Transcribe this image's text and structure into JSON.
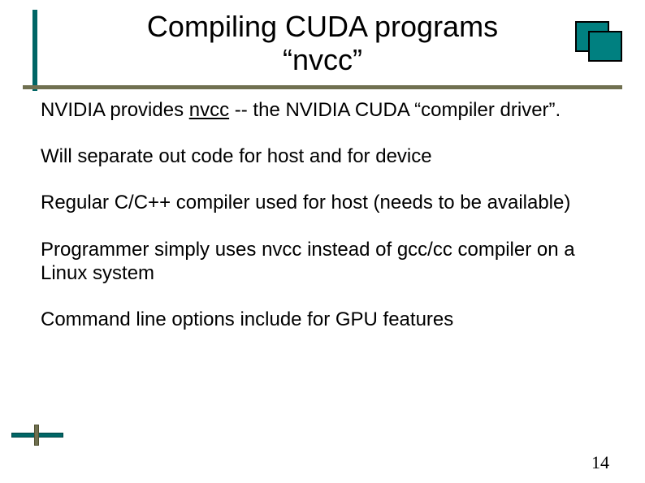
{
  "title": {
    "line1": "Compiling CUDA programs",
    "line2": "“nvcc”"
  },
  "paragraphs": {
    "p1_pre": "NVIDIA provides ",
    "p1_underlined": "nvcc",
    "p1_post": " -- the NVIDIA CUDA “compiler driver”.",
    "p2": "Will separate out code for host and for device",
    "p3": "Regular C/C++ compiler used for host (needs to be available)",
    "p4": "Programmer simply uses nvcc instead of gcc/cc compiler on a Linux system",
    "p5": "Command line options include for GPU features"
  },
  "page_number": "14",
  "colors": {
    "accent_teal": "#006666",
    "accent_olive": "#707050"
  }
}
